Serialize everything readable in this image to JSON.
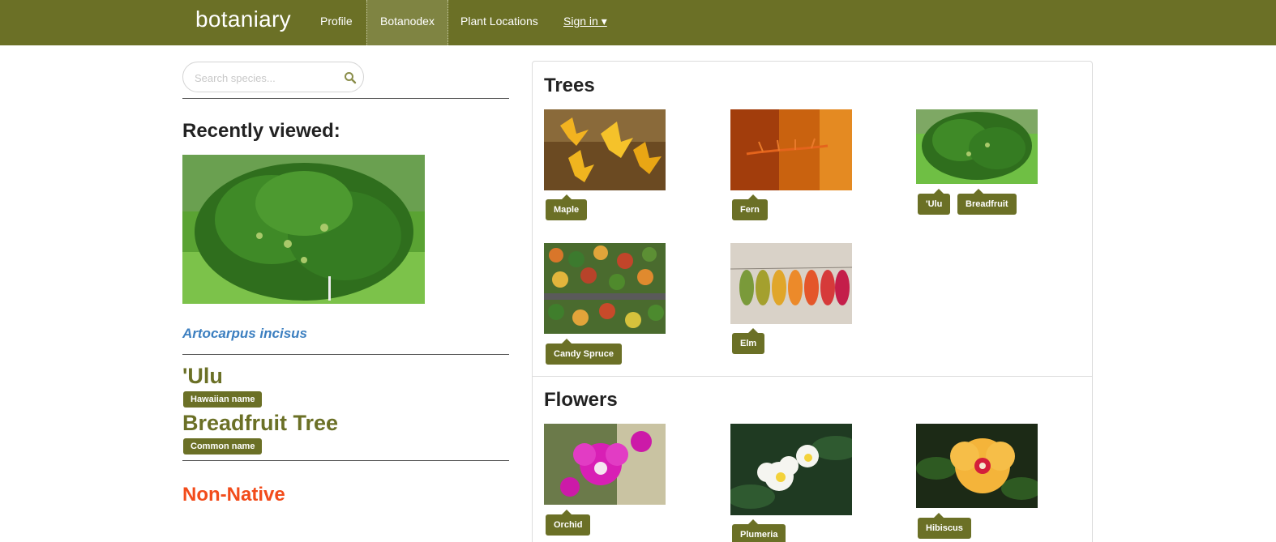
{
  "nav": {
    "brand": "botaniary",
    "links": [
      {
        "label": "Profile"
      },
      {
        "label": "Botanodex"
      },
      {
        "label": "Plant Locations"
      },
      {
        "label": "Sign in ▾"
      }
    ]
  },
  "search": {
    "placeholder": "Search species..."
  },
  "recent": {
    "title": "Recently viewed:",
    "scientific_name": "Artocarpus incisus",
    "names": [
      {
        "name": "'Ulu",
        "badge": "Hawaiian name"
      },
      {
        "name": "Breadfruit Tree",
        "badge": "Common name"
      }
    ],
    "status": "Non-Native"
  },
  "sections": [
    {
      "title": "Trees",
      "items": [
        {
          "tags": [
            "Maple"
          ]
        },
        {
          "tags": [
            "Fern"
          ]
        },
        {
          "tags": [
            "'Ulu",
            "Breadfruit"
          ]
        },
        {
          "tags": [
            "Candy Spruce"
          ]
        },
        {
          "tags": [
            "Elm"
          ]
        }
      ]
    },
    {
      "title": "Flowers",
      "items": [
        {
          "tags": [
            "Orchid"
          ]
        },
        {
          "tags": [
            "Plumeria"
          ]
        },
        {
          "tags": [
            "Hibiscus"
          ]
        }
      ]
    }
  ],
  "colors": {
    "brand": "#6b7026",
    "link": "#3c7fc0",
    "status": "#f24c1b"
  }
}
